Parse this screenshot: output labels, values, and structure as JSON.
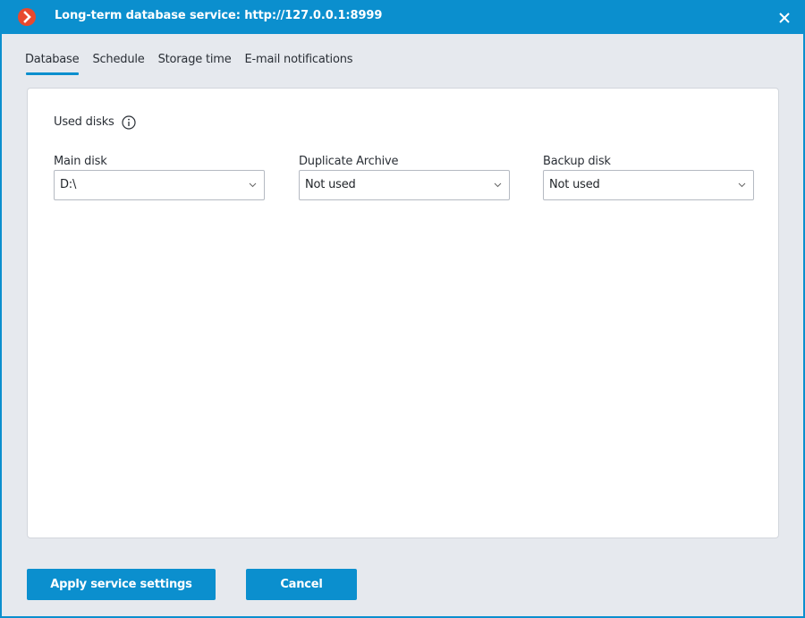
{
  "window": {
    "title": "Long-term database service: http://127.0.0.1:8999",
    "icon": "app-logo-chevron-icon",
    "close_icon": "close-icon"
  },
  "tabs": [
    {
      "label": "Database",
      "active": true
    },
    {
      "label": "Schedule",
      "active": false
    },
    {
      "label": "Storage time",
      "active": false
    },
    {
      "label": "E-mail notifications",
      "active": false
    }
  ],
  "database": {
    "section_label": "Used disks",
    "info_icon": "info-icon",
    "fields": [
      {
        "label": "Main disk",
        "value": "D:\\"
      },
      {
        "label": "Duplicate Archive",
        "value": "Not used"
      },
      {
        "label": "Backup disk",
        "value": "Not used"
      }
    ]
  },
  "buttons": {
    "apply": "Apply service settings",
    "cancel": "Cancel"
  },
  "colors": {
    "accent": "#0b8fce",
    "logo": "#e8492e",
    "background": "#e6e9ee"
  }
}
